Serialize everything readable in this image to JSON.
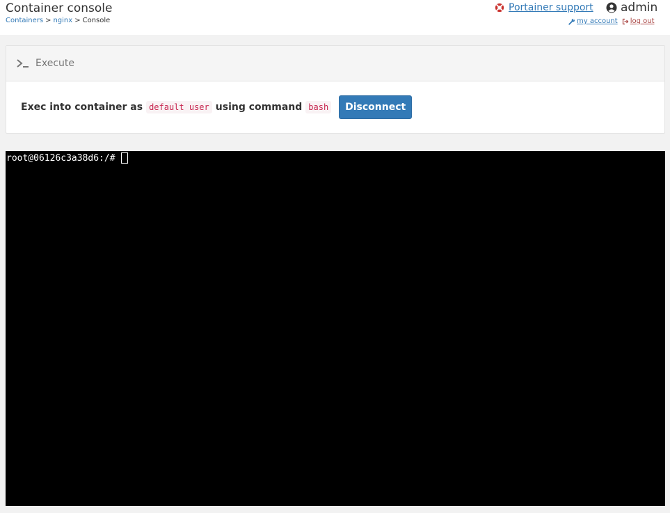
{
  "header": {
    "title": "Container console",
    "breadcrumb": {
      "items": [
        "Containers",
        "nginx",
        "Console"
      ],
      "separator": ">"
    },
    "support_link": "Portainer support",
    "username": "admin",
    "my_account_link": "my account",
    "logout_link": "log out"
  },
  "execute": {
    "title": "Execute",
    "text_prefix": "Exec into container as",
    "user": "default user",
    "text_middle": "using command",
    "command": "bash",
    "disconnect_label": "Disconnect"
  },
  "terminal": {
    "prompt": "root@06126c3a38d6:/#"
  },
  "icons": {
    "support": "life-ring-icon",
    "user": "user-circle-icon",
    "account": "wrench-icon",
    "logout": "sign-out-icon",
    "execute": "terminal-icon"
  },
  "colors": {
    "link": "#337ab7",
    "logout": "#a94442",
    "button": "#337ab7",
    "code_text": "#c7254e",
    "terminal_bg": "#000000"
  }
}
